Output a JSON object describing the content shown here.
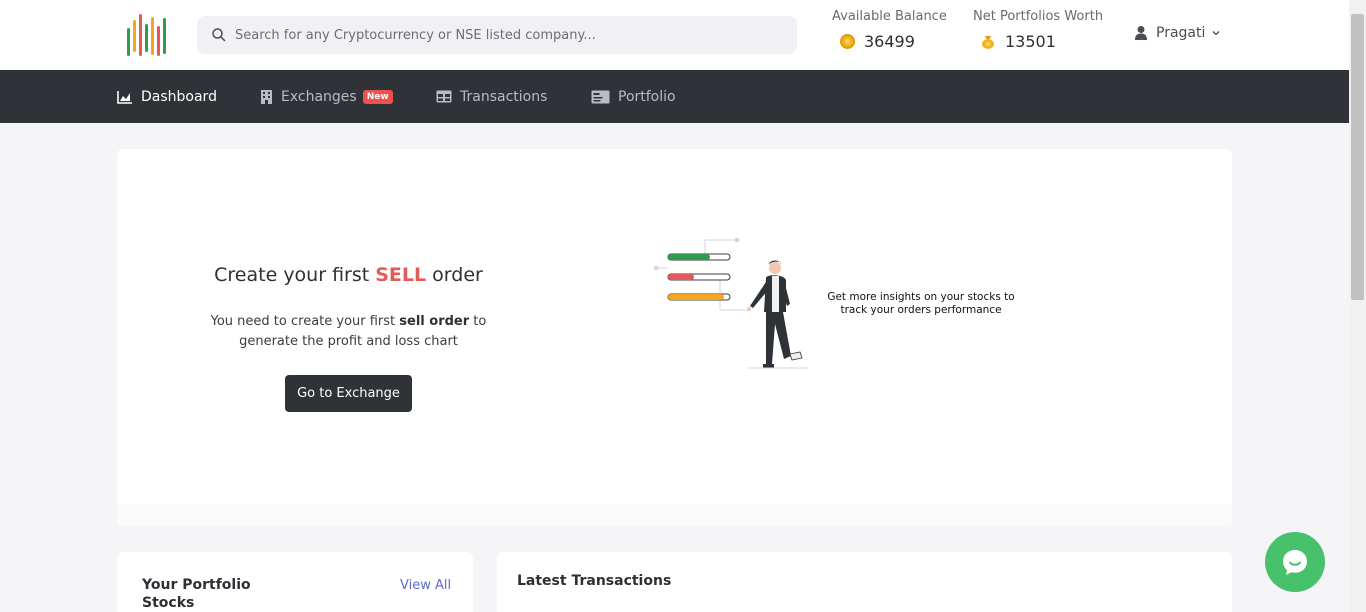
{
  "header": {
    "search": {
      "placeholder": "Search for any Cryptocurrency or NSE listed company..."
    },
    "available_balance": {
      "label": "Available Balance",
      "value": "36499"
    },
    "net_worth": {
      "label": "Net Portfolios Worth",
      "value": "13501"
    },
    "user": {
      "name": "Pragati"
    }
  },
  "nav": {
    "dashboard": "Dashboard",
    "exchanges": "Exchanges",
    "exchanges_badge": "New",
    "transactions": "Transactions",
    "portfolio": "Portfolio"
  },
  "cta": {
    "title_pre": "Create your first ",
    "title_highlight": "SELL",
    "title_post": " order",
    "text_pre": "You need to create your first ",
    "text_bold": "sell order",
    "text_post": " to generate the profit and loss chart",
    "button": "Go to Exchange",
    "insight": "Get more insights on your stocks to track your orders performance"
  },
  "portfolio": {
    "title": "Your Portfolio Stocks",
    "view_all": "View All"
  },
  "transactions": {
    "title": "Latest Transactions"
  },
  "colors": {
    "accent_red": "#e35a5a",
    "nav_bg": "#2f3337",
    "chat_green": "#47c16b",
    "link": "#5f6bd0"
  }
}
